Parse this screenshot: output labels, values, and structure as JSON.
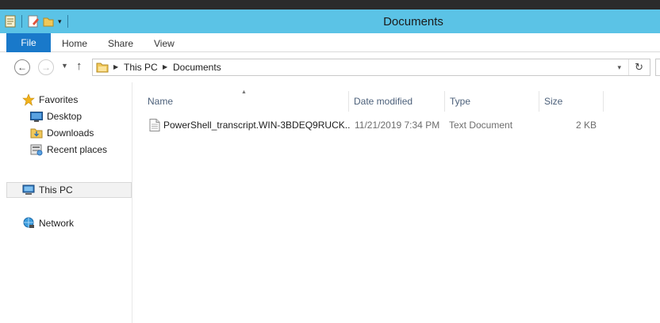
{
  "window": {
    "title": "Documents"
  },
  "ribbon": {
    "file_label": "File",
    "tabs": [
      "Home",
      "Share",
      "View"
    ]
  },
  "address": {
    "crumbs": [
      "This PC",
      "Documents"
    ]
  },
  "nav_pane": {
    "favorites": "Favorites",
    "items": [
      "Desktop",
      "Downloads",
      "Recent places"
    ],
    "this_pc": "This PC",
    "network": "Network"
  },
  "columns": {
    "name": "Name",
    "date": "Date modified",
    "type": "Type",
    "size": "Size"
  },
  "files": [
    {
      "name": "PowerShell_transcript.WIN-3BDEQ9RUCK...",
      "date": "11/21/2019 7:34 PM",
      "type": "Text Document",
      "size": "2 KB"
    }
  ],
  "colors": {
    "title_bar": "#5bc3e6",
    "file_tab": "#1979ca",
    "column_header_text": "#4c607a"
  }
}
